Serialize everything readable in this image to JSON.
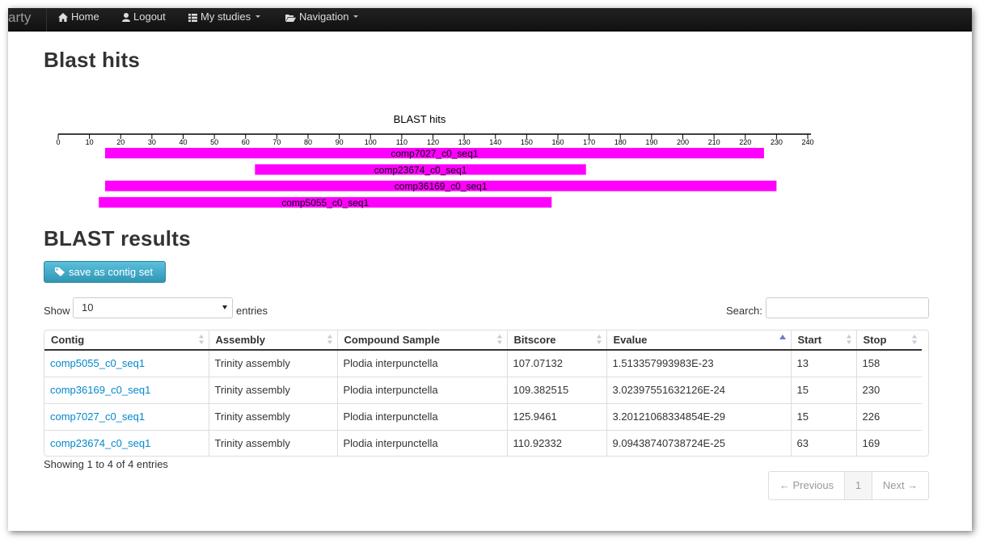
{
  "navbar": {
    "brand": "arty",
    "items": [
      {
        "label": "Home",
        "icon": "home-icon"
      },
      {
        "label": "Logout",
        "icon": "user-icon"
      },
      {
        "label": "My studies",
        "icon": "list-icon",
        "dropdown": true
      },
      {
        "label": "Navigation",
        "icon": "folder-open-icon",
        "dropdown": true
      }
    ]
  },
  "page_title": "Blast hits",
  "chart_data": {
    "type": "bar",
    "title": "BLAST hits",
    "xlim": [
      0,
      240
    ],
    "ticks": [
      0,
      10,
      20,
      30,
      40,
      50,
      60,
      70,
      80,
      90,
      100,
      110,
      120,
      130,
      140,
      150,
      160,
      170,
      180,
      190,
      200,
      210,
      220,
      230,
      240
    ],
    "bar_color": "#ff00ff",
    "hits": [
      {
        "name": "comp7027_c0_seq1",
        "start": 15,
        "stop": 226
      },
      {
        "name": "comp23674_c0_seq1",
        "start": 63,
        "stop": 169
      },
      {
        "name": "comp36169_c0_seq1",
        "start": 15,
        "stop": 230
      },
      {
        "name": "comp5055_c0_seq1",
        "start": 13,
        "stop": 158
      }
    ]
  },
  "results_title": "BLAST results",
  "save_button_label": "save as contig set",
  "length_menu": {
    "prefix": "Show",
    "selected": "10",
    "suffix": "entries"
  },
  "search": {
    "label": "Search:",
    "value": ""
  },
  "table": {
    "columns": [
      "Contig",
      "Assembly",
      "Compound Sample",
      "Bitscore",
      "Evalue",
      "Start",
      "Stop"
    ],
    "rows": [
      {
        "contig": "comp5055_c0_seq1",
        "assembly": "Trinity assembly",
        "sample": "Plodia interpunctella",
        "bitscore": "107.07132",
        "evalue": "1.513357993983E-23",
        "start": "13",
        "stop": "158"
      },
      {
        "contig": "comp36169_c0_seq1",
        "assembly": "Trinity assembly",
        "sample": "Plodia interpunctella",
        "bitscore": "109.382515",
        "evalue": "3.02397551632126E-24",
        "start": "15",
        "stop": "230"
      },
      {
        "contig": "comp7027_c0_seq1",
        "assembly": "Trinity assembly",
        "sample": "Plodia interpunctella",
        "bitscore": "125.9461",
        "evalue": "3.20121068334854E-29",
        "start": "15",
        "stop": "226"
      },
      {
        "contig": "comp23674_c0_seq1",
        "assembly": "Trinity assembly",
        "sample": "Plodia interpunctella",
        "bitscore": "110.92332",
        "evalue": "9.09438740738724E-25",
        "start": "63",
        "stop": "169"
      }
    ]
  },
  "info": "Showing 1 to 4 of 4 entries",
  "pagination": {
    "previous": "← Previous",
    "current": "1",
    "next": "Next →"
  }
}
